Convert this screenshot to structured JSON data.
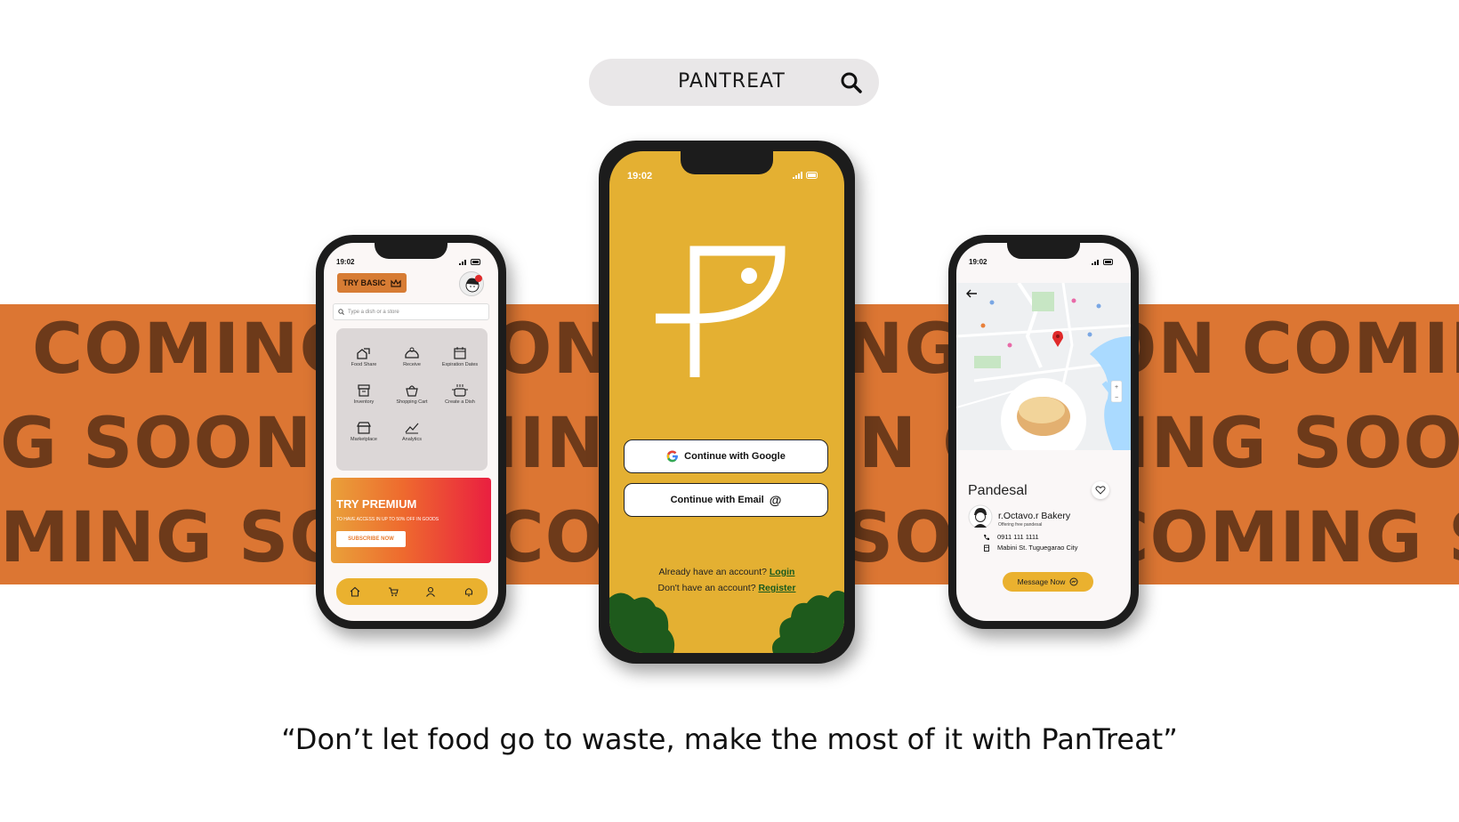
{
  "search": {
    "label": "PANTREAT"
  },
  "band": {
    "row1": "COMING SOON  COMING SOON  COMING SOON  COMING SOON",
    "row2": "G SOON  COMING SOON  COMING SOON  COMING SOON  COMING",
    "row3": "MING SOON  COMING SOON  COMING SOON  COMING SOON  CO"
  },
  "left_phone": {
    "time": "19:02",
    "try_basic": "TRY BASIC",
    "search_placeholder": "Type a dish or a store",
    "grid": [
      {
        "label": "Food Share",
        "icon": "food-share-icon"
      },
      {
        "label": "Receive",
        "icon": "receive-icon"
      },
      {
        "label": "Expiration Dates",
        "icon": "calendar-icon"
      },
      {
        "label": "Inventory",
        "icon": "inventory-icon"
      },
      {
        "label": "Shopping Cart",
        "icon": "shopping-cart-icon"
      },
      {
        "label": "Create a Dish",
        "icon": "pot-icon"
      },
      {
        "label": "Marketplace",
        "icon": "store-icon"
      },
      {
        "label": "Analytics",
        "icon": "analytics-icon"
      }
    ],
    "premium_title": "TRY PREMIUM",
    "premium_sub": "TO HAVE ACCESS IN UP TO 50% OFF IN GOODS",
    "premium_button": "SUBSCRIBE NOW",
    "nav": [
      "home-icon",
      "cart-icon",
      "profile-icon",
      "bell-icon"
    ]
  },
  "center_phone": {
    "time": "19:02",
    "google_button": "Continue with Google",
    "email_button": "Continue with Email",
    "have_account": "Already have an account?",
    "login": "Login",
    "no_account": "Don't have an account?",
    "register": "Register"
  },
  "right_phone": {
    "time": "19:02",
    "product": "Pandesal",
    "store": "r.Octavo.r Bakery",
    "store_sub": "Offering free pandesal",
    "phone": "0911 111 1111",
    "address": "Mabini St. Tuguegarao City",
    "message_button": "Message Now"
  },
  "tagline": "“Don’t let food go to waste, make the most of it with PanTreat”",
  "colors": {
    "accent_yellow": "#e4b032",
    "band_orange": "#dc7633",
    "band_text": "#6d3a1a",
    "dark_green": "#1e5a1c"
  }
}
